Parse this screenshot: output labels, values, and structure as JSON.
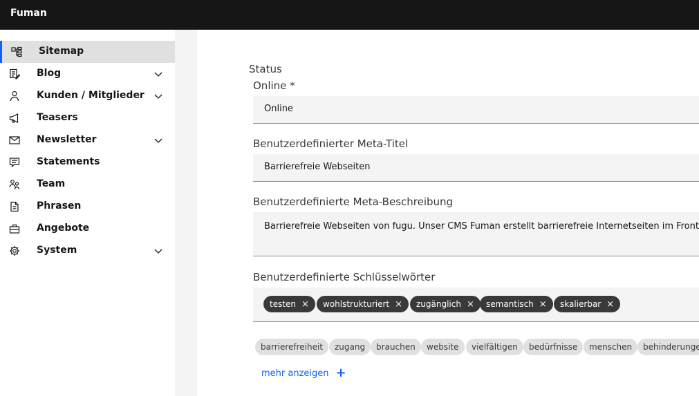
{
  "app": {
    "title": "Fuman"
  },
  "sidebar": {
    "items": [
      {
        "label": "Sitemap",
        "icon": "sitemap-icon",
        "active": true,
        "expandable": false
      },
      {
        "label": "Blog",
        "icon": "blog-icon",
        "active": false,
        "expandable": true
      },
      {
        "label": "Kunden / Mitglieder",
        "icon": "user-icon",
        "active": false,
        "expandable": true
      },
      {
        "label": "Teasers",
        "icon": "megaphone-icon",
        "active": false,
        "expandable": false
      },
      {
        "label": "Newsletter",
        "icon": "mail-icon",
        "active": false,
        "expandable": true
      },
      {
        "label": "Statements",
        "icon": "chat-icon",
        "active": false,
        "expandable": false
      },
      {
        "label": "Team",
        "icon": "team-icon",
        "active": false,
        "expandable": false
      },
      {
        "label": "Phrasen",
        "icon": "document-icon",
        "active": false,
        "expandable": false
      },
      {
        "label": "Angebote",
        "icon": "briefcase-icon",
        "active": false,
        "expandable": false
      },
      {
        "label": "System",
        "icon": "gear-icon",
        "active": false,
        "expandable": true
      }
    ]
  },
  "form": {
    "status_heading": "Status",
    "online": {
      "label": "Online *",
      "value": "Online"
    },
    "meta_title": {
      "label": "Benutzerdefinierter Meta-Titel",
      "value": "Barrierefreie Webseiten"
    },
    "meta_description": {
      "label": "Benutzerdefinierte Meta-Beschreibung",
      "value": "Barrierefreie Webseiten von fugu. Unser CMS Fuman erstellt barrierefreie Internetseiten im Frontend"
    },
    "keywords": {
      "label": "Benutzerdefinierte Schlüsselwörter",
      "tags": [
        "testen",
        "wohlstrukturiert",
        "zugänglich",
        "semantisch",
        "skalierbar"
      ],
      "remove_symbol": "×",
      "suggestions": [
        "barrierefreiheit",
        "zugang",
        "brauchen",
        "website",
        "vielfältigen",
        "bedürfnisse",
        "menschen",
        "behinderungen"
      ],
      "more_label": "mehr anzeigen",
      "more_symbol": "+"
    }
  },
  "colors": {
    "topbar": "#161616",
    "accent": "#0f62fe",
    "chip": "#393939",
    "suggestion": "#e0e0e0"
  }
}
